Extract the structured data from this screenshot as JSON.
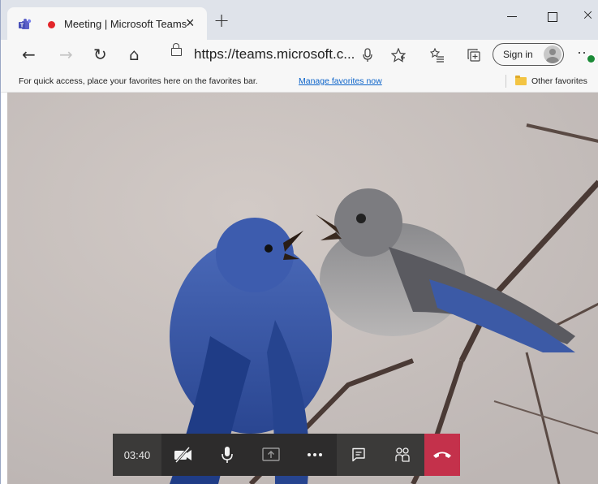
{
  "browser": {
    "tab": {
      "title": "Meeting | Microsoft Teams",
      "close_glyph": "×"
    },
    "new_tab_glyph": "+",
    "window_controls": {
      "close_glyph": "×"
    },
    "nav": {
      "back_glyph": "←",
      "forward_glyph": "→",
      "refresh_glyph": "↻",
      "home_glyph": "⌂"
    },
    "address": {
      "url": "https://teams.microsoft.c..."
    },
    "toolbar_icons": [
      "mic-icon",
      "favorite-star-icon",
      "favorites-list-icon",
      "collections-icon"
    ],
    "profile": {
      "sign_in_label": "Sign in"
    },
    "menu_glyph": "··"
  },
  "favorites_bar": {
    "message": "For quick access, place your favorites here on the favorites bar.",
    "manage_link": "Manage favorites now",
    "other_favorites": "Other favorites"
  },
  "meeting": {
    "timer": "03:40",
    "controls": [
      "camera-off-icon",
      "microphone-icon",
      "share-screen-icon",
      "more-actions-icon",
      "chat-icon",
      "participants-icon",
      "hang-up-icon"
    ],
    "colors": {
      "hang_up": "#c4314b",
      "toolbar": "#3b3a39",
      "toolbar_dark": "#2d2c2c"
    }
  }
}
